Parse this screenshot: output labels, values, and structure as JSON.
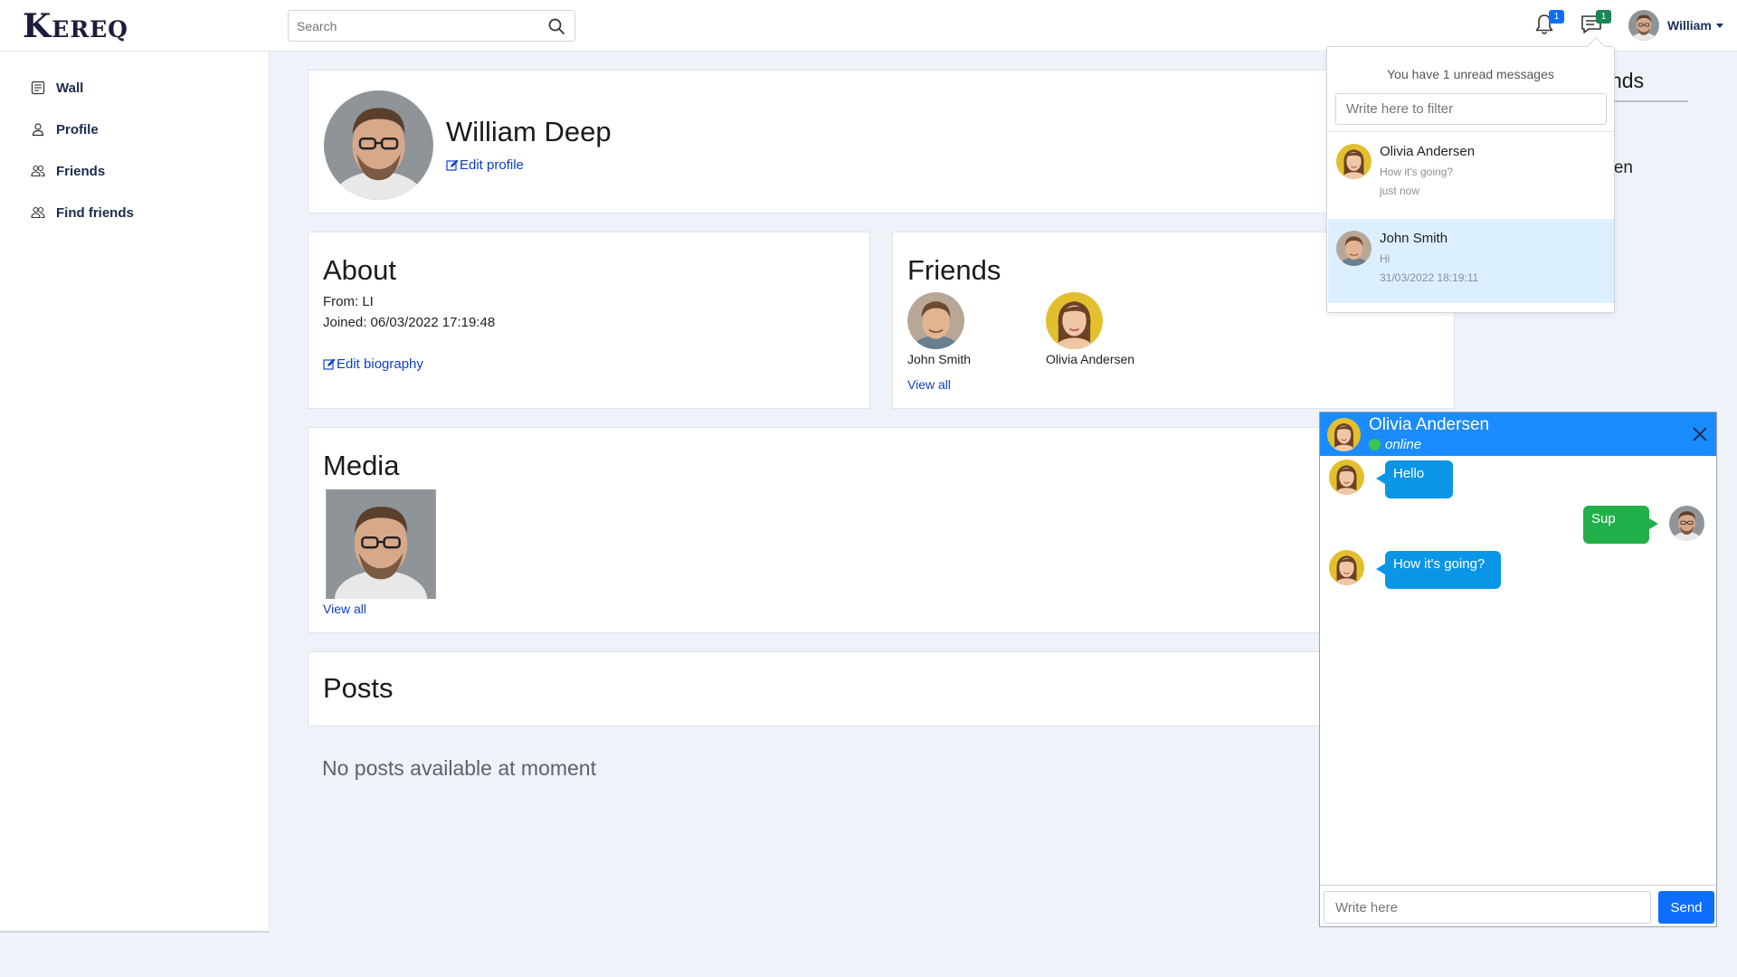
{
  "app": {
    "logo": "Kereq"
  },
  "search": {
    "placeholder": "Search"
  },
  "notifications": {
    "count": "1"
  },
  "messages_nav": {
    "count": "1"
  },
  "user": {
    "name": "William"
  },
  "sidebar": {
    "items": [
      {
        "label": "Wall",
        "icon": "wall-icon"
      },
      {
        "label": "Profile",
        "icon": "person-icon"
      },
      {
        "label": "Friends",
        "icon": "people-icon"
      },
      {
        "label": "Find friends",
        "icon": "people-icon"
      }
    ]
  },
  "profile": {
    "name": "William Deep",
    "edit_profile": "Edit profile"
  },
  "about": {
    "title": "About",
    "from": "From: LI",
    "joined": "Joined: 06/03/2022 17:19:48",
    "edit_biography": "Edit biography"
  },
  "friends": {
    "title": "Friends",
    "list": [
      {
        "name": "John Smith"
      },
      {
        "name": "Olivia Andersen"
      }
    ],
    "view_all": "View all"
  },
  "media": {
    "title": "Media",
    "view_all": "View all"
  },
  "posts": {
    "title": "Posts",
    "empty": "No posts available at moment"
  },
  "right_panel": {
    "title_partial": "nds",
    "name_partial": "rsen"
  },
  "messages_dropdown": {
    "header": "You have 1 unread messages",
    "filter_placeholder": "Write here to filter",
    "items": [
      {
        "name": "Olivia Andersen",
        "message": "How it's going?",
        "time": "just now"
      },
      {
        "name": "John Smith",
        "message": "Hi",
        "time": "31/03/2022 18:19:11"
      }
    ]
  },
  "chat": {
    "contact": "Olivia Andersen",
    "status": "online",
    "messages": [
      {
        "from": "them",
        "text": "Hello"
      },
      {
        "from": "me",
        "text": "Sup"
      },
      {
        "from": "them",
        "text": "How it's going?"
      }
    ],
    "input_placeholder": "Write here",
    "send_label": "Send"
  },
  "colors": {
    "accent": "#0d6efd",
    "chat_header": "#1a8cff",
    "incoming_bubble": "#0a96e6",
    "outgoing_bubble": "#21b04a",
    "online": "#3cc44e"
  }
}
